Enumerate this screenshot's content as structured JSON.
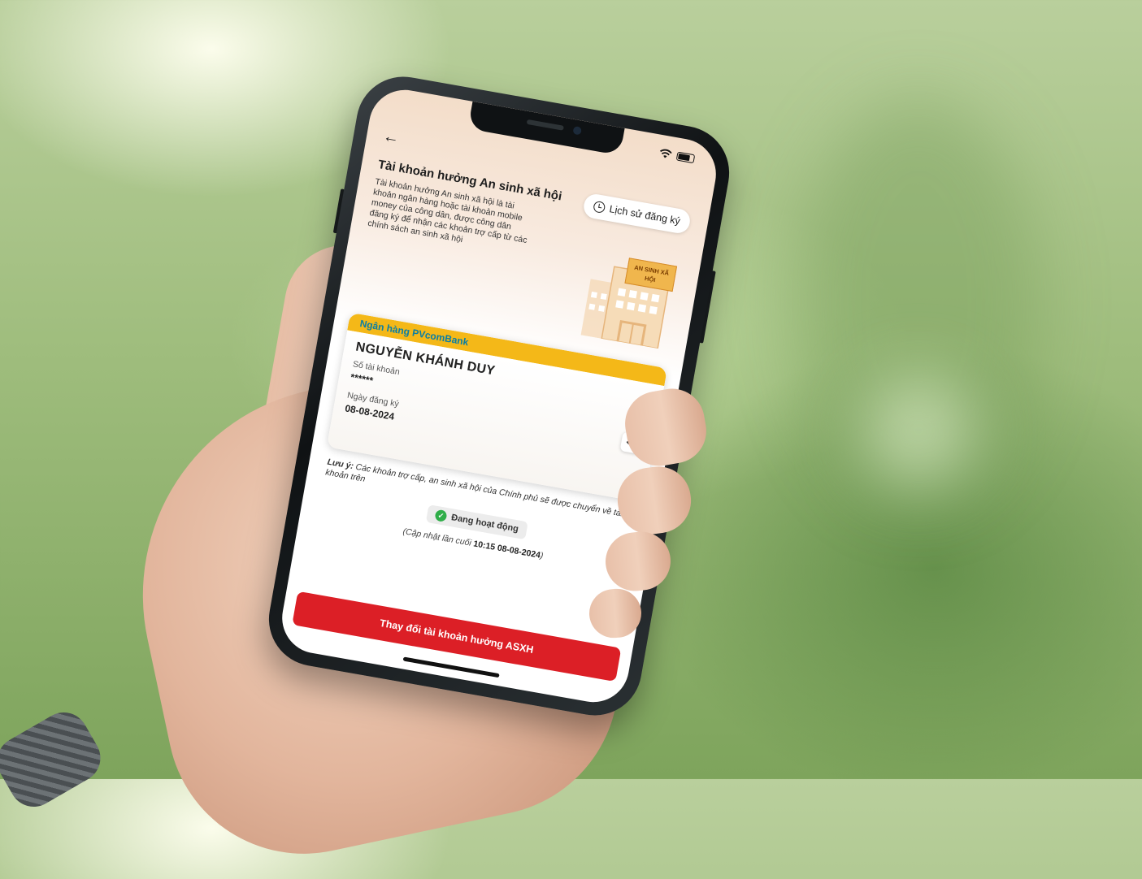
{
  "screen": {
    "title": "Tài khoản hưởng An sinh xã hội",
    "description": "Tài khoản hưởng An sinh xã hội là tài khoản ngân hàng hoặc tài khoản mobile money của công dân, được công dân đăng ký để nhận các khoản trợ cấp từ các chính sách an sinh xã hội",
    "history_button": "Lịch sử đăng ký",
    "illustration_sign": "AN SINH XÃ HỘI"
  },
  "card": {
    "bank": "Ngân hàng PVcomBank",
    "holder": "NGUYỄN KHÁNH DUY",
    "account_label": "Số tài khoản",
    "account_value": "******",
    "reg_label": "Ngày đăng ký",
    "reg_value": "08-08-2024"
  },
  "note": {
    "prefix": "Lưu ý:",
    "text": "Các khoản trợ cấp, an sinh xã hội của Chính phủ sẽ được chuyển về tài khoản trên"
  },
  "status": {
    "label": "Đang hoạt động",
    "update_prefix": "(Cập nhật lần cuối",
    "update_time": "10:15 08-08-2024",
    "update_suffix": ")"
  },
  "cta": {
    "label": "Thay đổi tài khoản hưởng ASXH"
  },
  "colors": {
    "accent": "#dc1f26",
    "band": "#f4b818",
    "bank_text": "#0a7ea4",
    "active": "#2fae49"
  },
  "icons": [
    "back-icon",
    "history-icon",
    "eye-icon",
    "check-icon",
    "wifi-icon",
    "battery-icon"
  ]
}
